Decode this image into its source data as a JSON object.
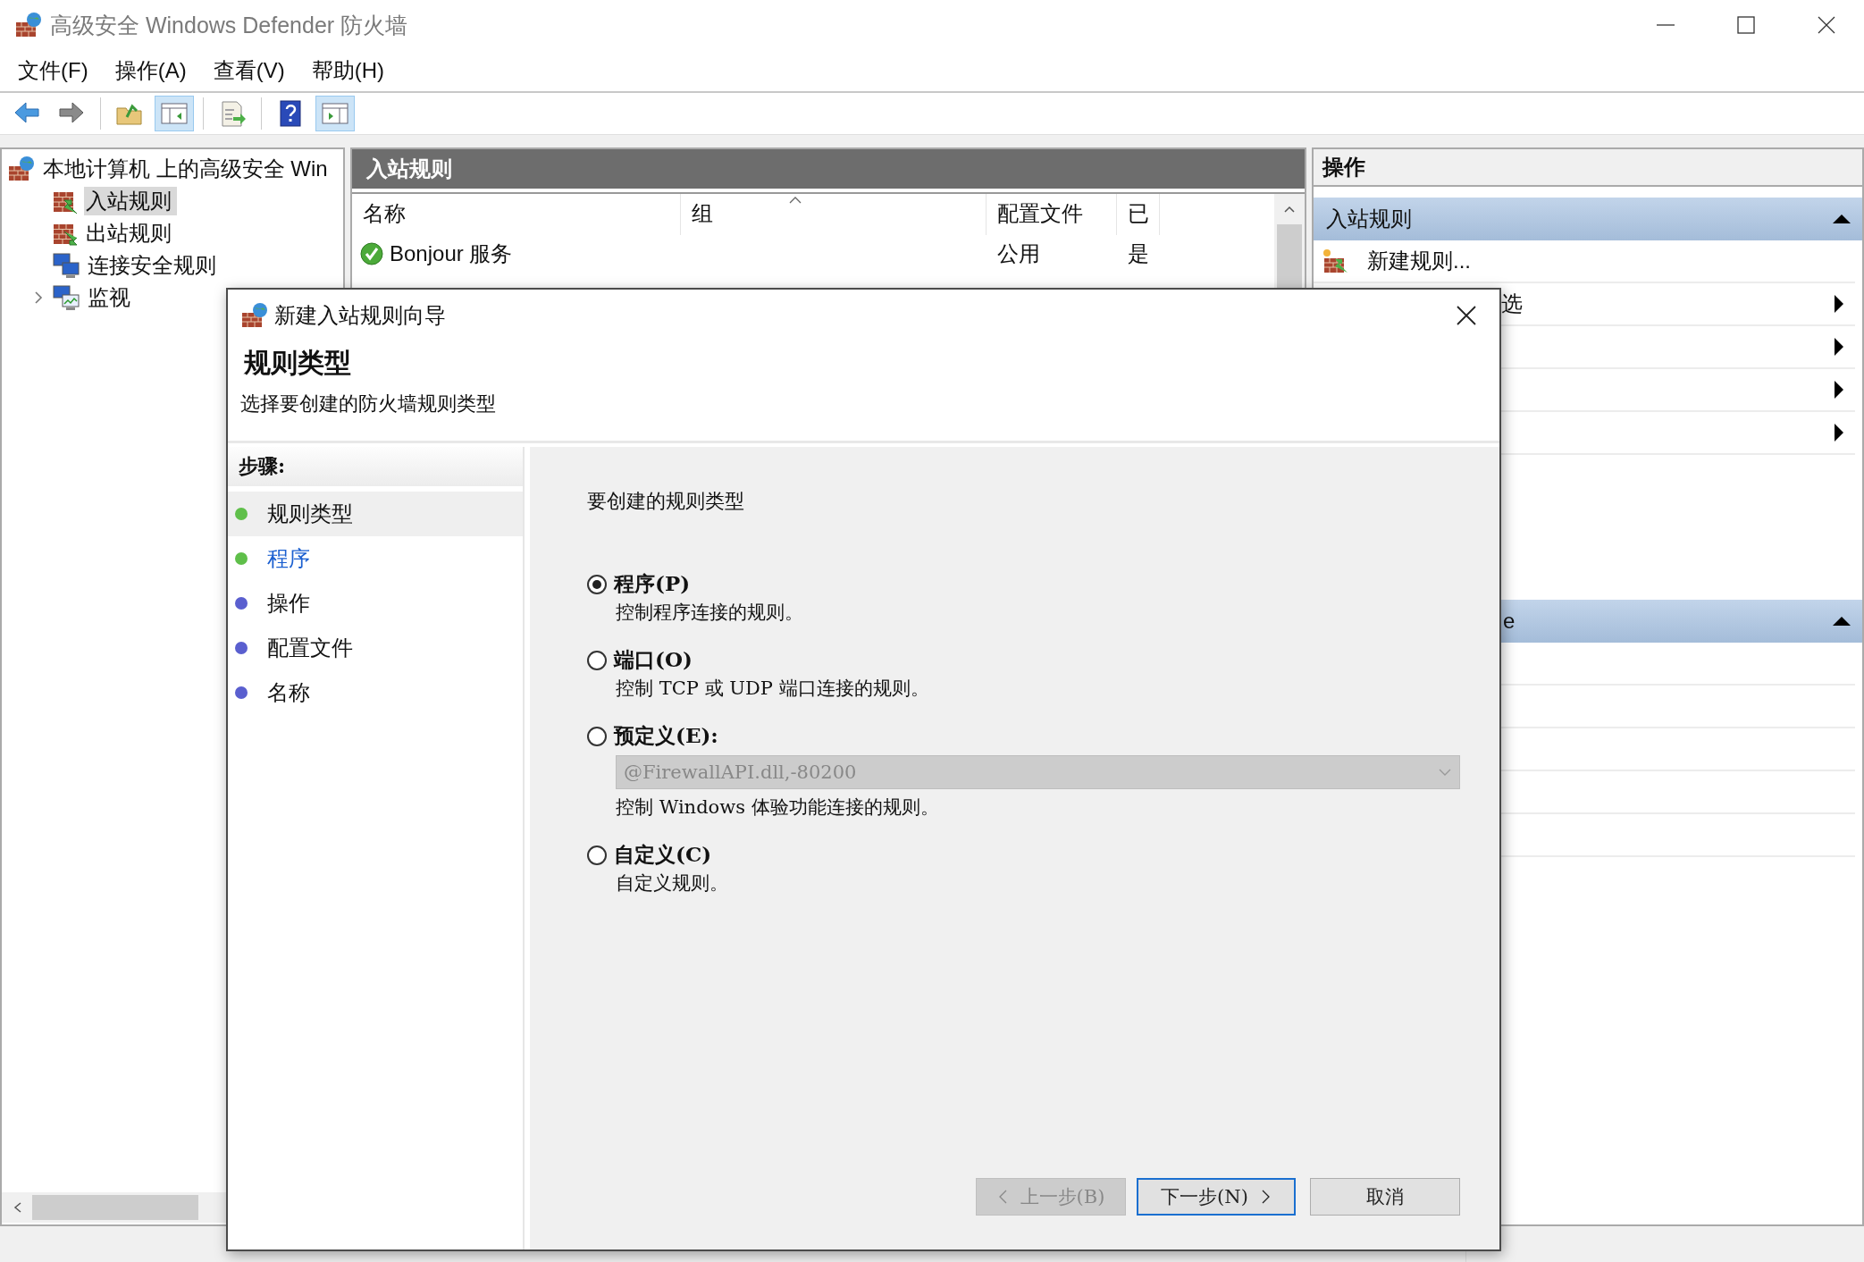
{
  "window": {
    "title": "高级安全 Windows Defender 防火墙"
  },
  "menu": [
    {
      "label": "文件(F)"
    },
    {
      "label": "操作(A)"
    },
    {
      "label": "查看(V)"
    },
    {
      "label": "帮助(H)"
    }
  ],
  "toolbar": [
    {
      "kind": "back",
      "selected": false
    },
    {
      "kind": "forward",
      "selected": false
    },
    {
      "kind": "separator"
    },
    {
      "kind": "up",
      "selected": false
    },
    {
      "kind": "tree",
      "selected": true
    },
    {
      "kind": "separator"
    },
    {
      "kind": "export",
      "selected": false
    },
    {
      "kind": "separator"
    },
    {
      "kind": "help",
      "selected": false
    },
    {
      "kind": "actions",
      "selected": true
    }
  ],
  "tree": {
    "items": [
      {
        "label": "本地计算机 上的高级安全 Win",
        "kind": "root",
        "selected": false,
        "children": [
          {
            "label": "入站规则",
            "kind": "inbound",
            "selected": true
          },
          {
            "label": "出站规则",
            "kind": "outbound",
            "selected": false
          },
          {
            "label": "连接安全规则",
            "kind": "connection",
            "selected": false
          },
          {
            "label": "监视",
            "kind": "monitor",
            "selected": false,
            "expanded": false
          }
        ]
      }
    ]
  },
  "rules_panel": {
    "title": "入站规则",
    "columns": [
      {
        "label": "名称",
        "sorted": false
      },
      {
        "label": "组",
        "sorted": true
      },
      {
        "label": "配置文件",
        "sorted": false
      },
      {
        "label": "已",
        "sorted": false
      }
    ],
    "rows": [
      {
        "name": "Bonjour 服务",
        "profile": "公用",
        "enabled": "是",
        "allowed": true
      }
    ]
  },
  "actions_panel": {
    "title": "操作",
    "sections": [
      {
        "title": "入站规则",
        "kind": "full",
        "expanded": true,
        "items": [
          {
            "label": "新建规则...",
            "kind": "new-rule"
          },
          {
            "label": "选",
            "kind": "submenu"
          },
          {
            "kind": "submenu"
          },
          {
            "kind": "submenu"
          },
          {
            "kind": "submenu"
          }
        ]
      },
      {
        "title": "e",
        "kind": "partial",
        "expanded": true
      }
    ]
  },
  "dialog": {
    "title": "新建入站规则向导",
    "heading": "规则类型",
    "subtitle": "选择要创建的防火墙规则类型",
    "steps_title": "步骤:",
    "steps": [
      {
        "label": "规则类型",
        "selected": true,
        "highlighted": false,
        "color": "#5fbf4a"
      },
      {
        "label": "程序",
        "selected": false,
        "highlighted": true,
        "color": "#5fbf4a"
      },
      {
        "label": "操作",
        "selected": false,
        "highlighted": false,
        "color": "#5a5fcf"
      },
      {
        "label": "配置文件",
        "selected": false,
        "highlighted": false,
        "color": "#5a5fcf"
      },
      {
        "label": "名称",
        "selected": false,
        "highlighted": false,
        "color": "#5a5fcf"
      }
    ],
    "prompt": "要创建的规则类型",
    "options": [
      {
        "label": "程序(P)",
        "description": "控制程序连接的规则。",
        "selected": true
      },
      {
        "label": "端口(O)",
        "description": "控制 TCP 或 UDP 端口连接的规则。",
        "selected": false
      },
      {
        "label": "预定义(E):",
        "dropdown": {
          "value": "@FirewallAPI.dll,-80200",
          "disabled": true
        },
        "description": "控制 Windows 体验功能连接的规则。",
        "selected": false
      },
      {
        "label": "自定义(C)",
        "description": "自定义规则。",
        "selected": false
      }
    ],
    "buttons": [
      {
        "label": "上一步(B)",
        "kind": "back",
        "disabled": true,
        "default": false
      },
      {
        "label": "下一步(N)",
        "kind": "next",
        "disabled": false,
        "default": true
      },
      {
        "label": "取消",
        "kind": "cancel",
        "disabled": false,
        "default": false
      }
    ]
  }
}
